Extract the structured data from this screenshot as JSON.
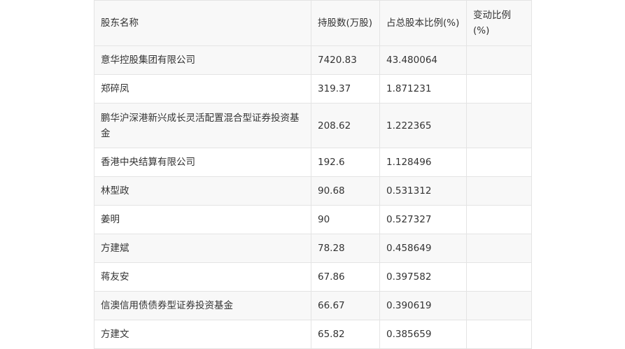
{
  "table": {
    "headers": [
      "股东名称",
      "持股数(万股)",
      "占总股本比例(%)",
      "变动比例(%)"
    ],
    "rows": [
      [
        "意华控股集团有限公司",
        "7420.83",
        "43.480064",
        ""
      ],
      [
        "郑碎凤",
        "319.37",
        "1.871231",
        ""
      ],
      [
        "鹏华沪深港新兴成长灵活配置混合型证券投资基金",
        "208.62",
        "1.222365",
        ""
      ],
      [
        "香港中央结算有限公司",
        "192.6",
        "1.128496",
        ""
      ],
      [
        "林型政",
        "90.68",
        "0.531312",
        ""
      ],
      [
        "姜明",
        "90",
        "0.527327",
        ""
      ],
      [
        "方建斌",
        "78.28",
        "0.458649",
        ""
      ],
      [
        "蒋友安",
        "67.86",
        "0.397582",
        ""
      ],
      [
        "信澳信用债债券型证券投资基金",
        "66.67",
        "0.390619",
        ""
      ],
      [
        "方建文",
        "65.82",
        "0.385659",
        ""
      ]
    ]
  }
}
